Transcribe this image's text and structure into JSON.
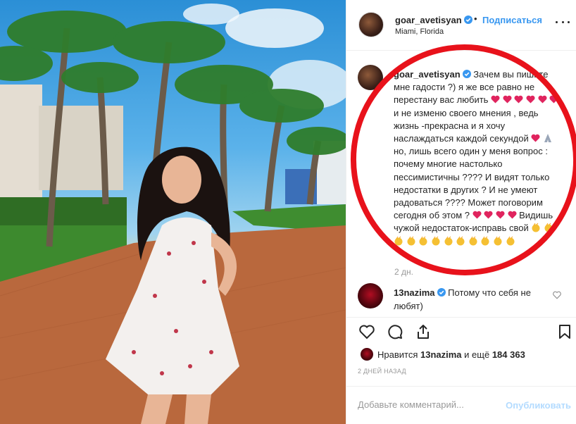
{
  "post": {
    "username": "goar_avetisyan",
    "separator": "•",
    "follow_label": "Подписаться",
    "location": "Miami, Florida"
  },
  "caption": {
    "username": "goar_avetisyan",
    "text_part1": "Зачем вы пишите мне гадости ?) я же все равно не перестану вас любить",
    "text_part2": "и не изменю своего мнения , ведь жизнь -прекрасна и я хочу наслаждаться каждой секундой",
    "text_part3": "но, лишь всего один у меня вопрос : почему многие настолько пессимистичны ???? И видят только недостатки в других ? И не умеют радоваться ???? Может поговорим сегодня об этом ?",
    "text_part4": "Видишь чужой недостаток-исправь свой",
    "time": "2 дн."
  },
  "comment": {
    "username": "13nazima",
    "text": "Потому что себя не любят)"
  },
  "likes": {
    "prefix": "Нравится",
    "user": "13nazima",
    "middle": "и ещё",
    "count": "184 363"
  },
  "date": "2 ДНЕЙ НАЗАД",
  "add_comment": {
    "placeholder": "Добавьте комментарий...",
    "post_label": "Опубликовать"
  },
  "colors": {
    "link": "#3897f0",
    "annotation_ring": "#e8121b",
    "heart": "#e0245e"
  }
}
